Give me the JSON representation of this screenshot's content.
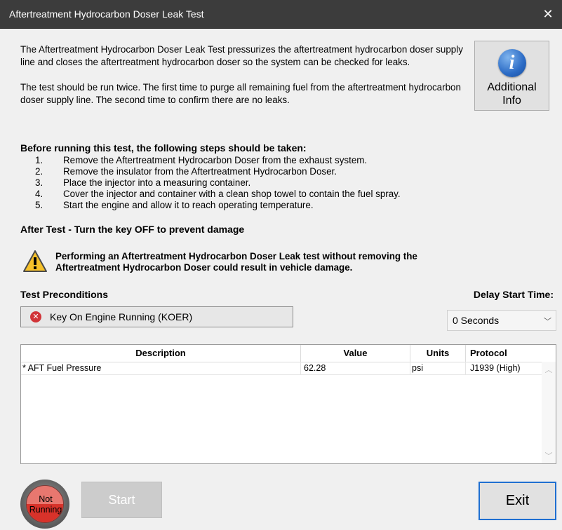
{
  "window": {
    "title": "Aftertreatment Hydrocarbon Doser Leak Test",
    "close_glyph": "✕"
  },
  "intro": {
    "paragraph1": "The Aftertreatment Hydrocarbon Doser Leak Test pressurizes the aftertreatment hydrocarbon doser supply line and closes the aftertreatment hydrocarbon doser so the system can be checked for leaks.",
    "paragraph2": "The test should be run twice.  The first time to purge all remaining fuel from the aftertreatment hydrocarbon doser supply line.  The second time to confirm there are no leaks."
  },
  "additional_info": {
    "label_line1": "Additional",
    "label_line2": "Info",
    "icon_glyph": "i"
  },
  "steps": {
    "title": "Before running this test, the following steps should be taken:",
    "items": [
      {
        "num": "1.",
        "text": "Remove the Aftertreatment Hydrocarbon Doser from the exhaust system."
      },
      {
        "num": "2.",
        "text": "Remove the insulator from the Aftertreatment Hydrocarbon Doser."
      },
      {
        "num": "3.",
        "text": "Place the injector into a measuring container."
      },
      {
        "num": "4.",
        "text": "Cover the injector and container with a clean shop towel to contain the fuel spray."
      },
      {
        "num": "5.",
        "text": "Start the engine and allow it to reach operating temperature."
      }
    ]
  },
  "after_test": "After Test - Turn the key OFF to prevent damage",
  "warning": {
    "line1": "Performing an Aftertreatment Hydrocarbon Doser Leak test without removing the",
    "line2": "Aftertreatment Hydrocarbon Doser could result in vehicle damage."
  },
  "preconditions": {
    "label": "Test Preconditions",
    "items": [
      {
        "text": "Key On Engine Running (KOER)",
        "status": "not-met"
      }
    ]
  },
  "delay": {
    "label": "Delay Start Time:",
    "selected": "0 Seconds"
  },
  "table": {
    "headers": {
      "description": "Description",
      "value": "Value",
      "units": "Units",
      "protocol": "Protocol"
    },
    "rows": [
      {
        "description": "* AFT Fuel Pressure",
        "value": "62.28",
        "units": "psi",
        "protocol": "J1939 (High)"
      }
    ]
  },
  "status": {
    "line1": "Not",
    "line2": "Running"
  },
  "buttons": {
    "start": "Start",
    "exit": "Exit"
  },
  "colors": {
    "titlebar": "#3c3c3c",
    "error_red": "#d13438",
    "exit_border": "#1f6fd1",
    "status_light": "#e8776f",
    "status_dark": "#d8322a"
  }
}
